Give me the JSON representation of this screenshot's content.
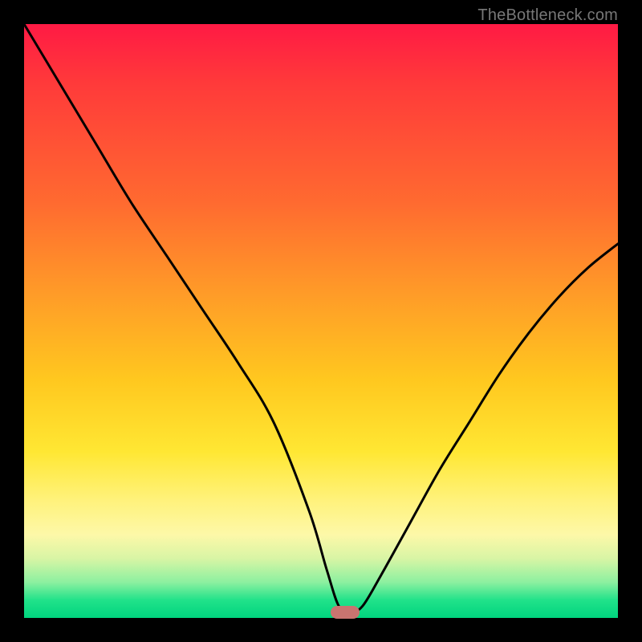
{
  "watermark": "TheBottleneck.com",
  "chart_data": {
    "type": "line",
    "title": "",
    "xlabel": "",
    "ylabel": "",
    "xlim": [
      0,
      100
    ],
    "ylim": [
      0,
      100
    ],
    "background_gradient": {
      "top_color": "#ff1a44",
      "mid_color": "#ffe733",
      "bottom_color": "#00d47e"
    },
    "series": [
      {
        "name": "bottleneck-curve",
        "x": [
          0,
          6,
          12,
          18,
          24,
          30,
          36,
          42,
          48,
          51,
          53,
          55,
          57,
          60,
          65,
          70,
          75,
          80,
          85,
          90,
          95,
          100
        ],
        "values": [
          100,
          90,
          80,
          70,
          61,
          52,
          43,
          33,
          18,
          8,
          2,
          1,
          2,
          7,
          16,
          25,
          33,
          41,
          48,
          54,
          59,
          63
        ]
      }
    ],
    "marker": {
      "x": 54,
      "y": 1,
      "color": "#c97470"
    }
  }
}
